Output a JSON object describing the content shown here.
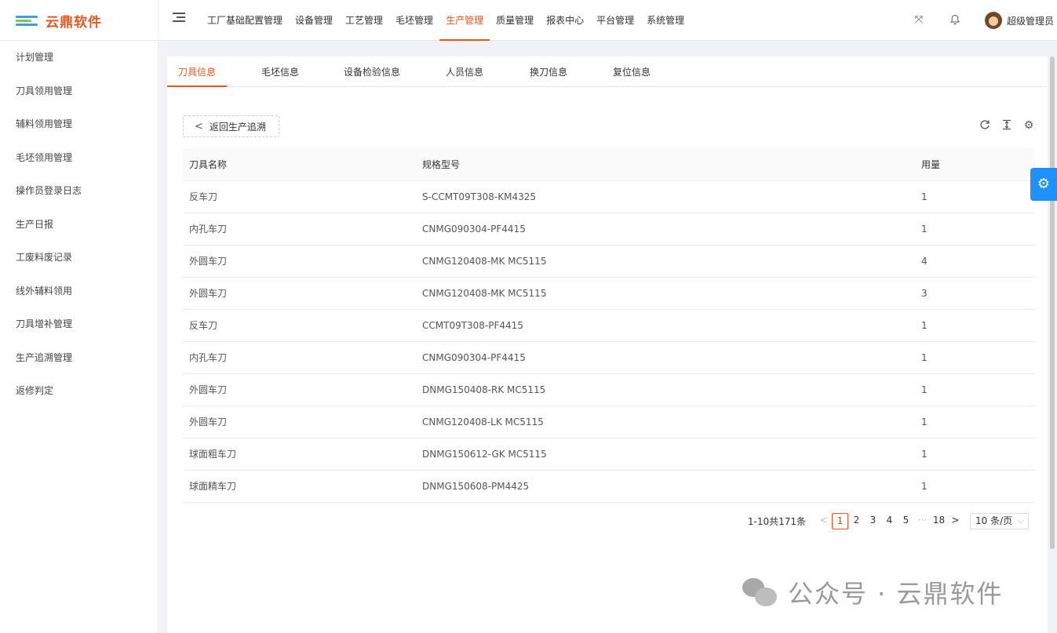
{
  "app": {
    "name": "云鼎软件"
  },
  "topnav": [
    {
      "label": "工厂基础配置管理",
      "active": false
    },
    {
      "label": "设备管理",
      "active": false
    },
    {
      "label": "工艺管理",
      "active": false
    },
    {
      "label": "毛坯管理",
      "active": false
    },
    {
      "label": "生产管理",
      "active": true
    },
    {
      "label": "质量管理",
      "active": false
    },
    {
      "label": "报表中心",
      "active": false
    },
    {
      "label": "平台管理",
      "active": false
    },
    {
      "label": "系统管理",
      "active": false
    }
  ],
  "header": {
    "username": "超级管理员",
    "fullscreen_icon": "expand-icon",
    "bell_icon": "bell-icon"
  },
  "sidebar": [
    {
      "label": "计划管理"
    },
    {
      "label": "刀具领用管理"
    },
    {
      "label": "辅料领用管理"
    },
    {
      "label": "毛坯领用管理"
    },
    {
      "label": "操作员登录日志"
    },
    {
      "label": "生产日报"
    },
    {
      "label": "工废料废记录"
    },
    {
      "label": "线外辅料领用"
    },
    {
      "label": "刀具增补管理"
    },
    {
      "label": "生产追溯管理"
    },
    {
      "label": "返修判定"
    }
  ],
  "tabs": [
    {
      "label": "刀具信息",
      "active": true
    },
    {
      "label": "毛坯信息",
      "active": false
    },
    {
      "label": "设备检验信息",
      "active": false
    },
    {
      "label": "人员信息",
      "active": false
    },
    {
      "label": "换刀信息",
      "active": false
    },
    {
      "label": "复位信息",
      "active": false
    }
  ],
  "back_button": {
    "label": "返回生产追溯"
  },
  "table": {
    "columns": [
      "刀具名称",
      "规格型号",
      "用量"
    ],
    "rows": [
      [
        "反车刀",
        "S-CCMT09T308-KM4325",
        "1"
      ],
      [
        "内孔车刀",
        "CNMG090304-PF4415",
        "1"
      ],
      [
        "外圆车刀",
        "CNMG120408-MK MC5115",
        "4"
      ],
      [
        "外圆车刀",
        "CNMG120408-MK MC5115",
        "3"
      ],
      [
        "反车刀",
        "CCMT09T308-PF4415",
        "1"
      ],
      [
        "内孔车刀",
        "CNMG090304-PF4415",
        "1"
      ],
      [
        "外圆车刀",
        "DNMG150408-RK MC5115",
        "1"
      ],
      [
        "外圆车刀",
        "CNMG120408-LK MC5115",
        "1"
      ],
      [
        "球面粗车刀",
        "DNMG150612-GK MC5115",
        "1"
      ],
      [
        "球面精车刀",
        "DNMG150608-PM4425",
        "1"
      ]
    ]
  },
  "pagination": {
    "total_text": "1-10共171条",
    "pages": [
      "1",
      "2",
      "3",
      "4",
      "5",
      "···",
      "18"
    ],
    "current": "1",
    "page_size": "10 条/页"
  },
  "watermark": {
    "text": "公众号 · 云鼎软件"
  },
  "colors": {
    "accent": "#e8561e",
    "settings_fab": "#1e90ff"
  }
}
